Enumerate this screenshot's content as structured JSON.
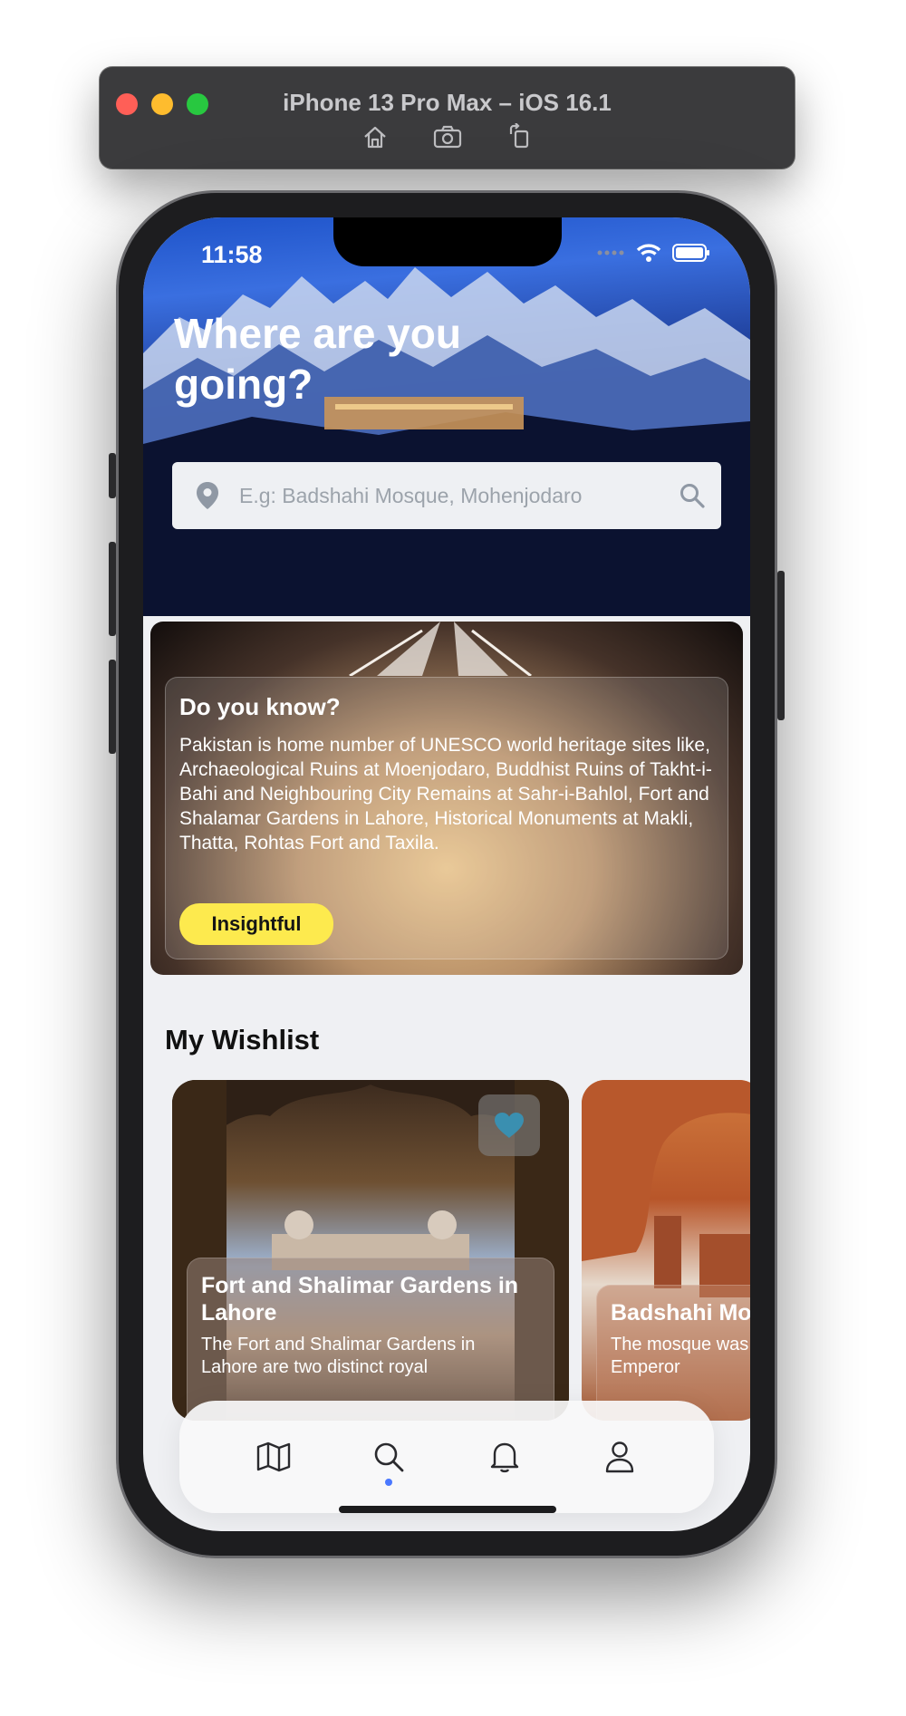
{
  "simulator": {
    "title": "iPhone 13 Pro Max – iOS 16.1",
    "tools": [
      "home-icon",
      "screenshot-icon",
      "rotate-icon"
    ]
  },
  "status_bar": {
    "time": "11:58"
  },
  "hero": {
    "title": "Where are you going?",
    "search_placeholder": "E.g: Badshahi Mosque, Mohenjodaro"
  },
  "fact_card": {
    "title": "Do you know?",
    "text": "Pakistan is home number of UNESCO world heritage sites like, Archaeological Ruins at Moenjodaro, Buddhist Ruins of Takht-i-Bahi and Neighbouring City Remains at Sahr-i-Bahlol, Fort and Shalamar Gardens in Lahore, Historical Monuments at Makli, Thatta, Rohtas Fort and Taxila.",
    "button_label": "Insightful"
  },
  "wishlist": {
    "title": "My Wishlist",
    "items": [
      {
        "name": "Fort and Shalimar Gardens in Lahore",
        "description": "The Fort and Shalimar Gardens in Lahore are two distinct royal",
        "favorited": true
      },
      {
        "name": "Badshahi Mo",
        "description": "The mosque was Mughal Emperor"
      }
    ]
  },
  "bottom_nav": {
    "items": [
      "map-icon",
      "search-icon",
      "bell-icon",
      "profile-icon"
    ],
    "active": "search-icon"
  },
  "colors": {
    "accent": "#4a78ff",
    "button_yellow": "#fdea4e",
    "heart": "#3a8fb0"
  }
}
